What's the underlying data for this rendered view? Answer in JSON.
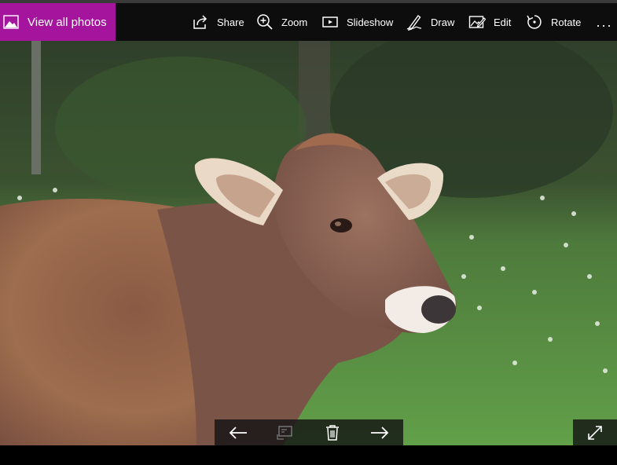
{
  "toolbar": {
    "view_all_label": "View all photos",
    "share_label": "Share",
    "zoom_label": "Zoom",
    "slideshow_label": "Slideshow",
    "draw_label": "Draw",
    "edit_label": "Edit",
    "rotate_label": "Rotate",
    "more_label": "..."
  },
  "colors": {
    "accent": "#a4149c",
    "toolbar_bg": "#0d0d0d"
  },
  "photo": {
    "subject": "cow-in-field"
  },
  "icons": [
    "photos-icon",
    "share-icon",
    "zoom-icon",
    "slideshow-icon",
    "draw-icon",
    "edit-icon",
    "rotate-icon",
    "more-icon",
    "previous-arrow-icon",
    "compare-icon",
    "delete-icon",
    "next-arrow-icon",
    "fullscreen-icon"
  ]
}
